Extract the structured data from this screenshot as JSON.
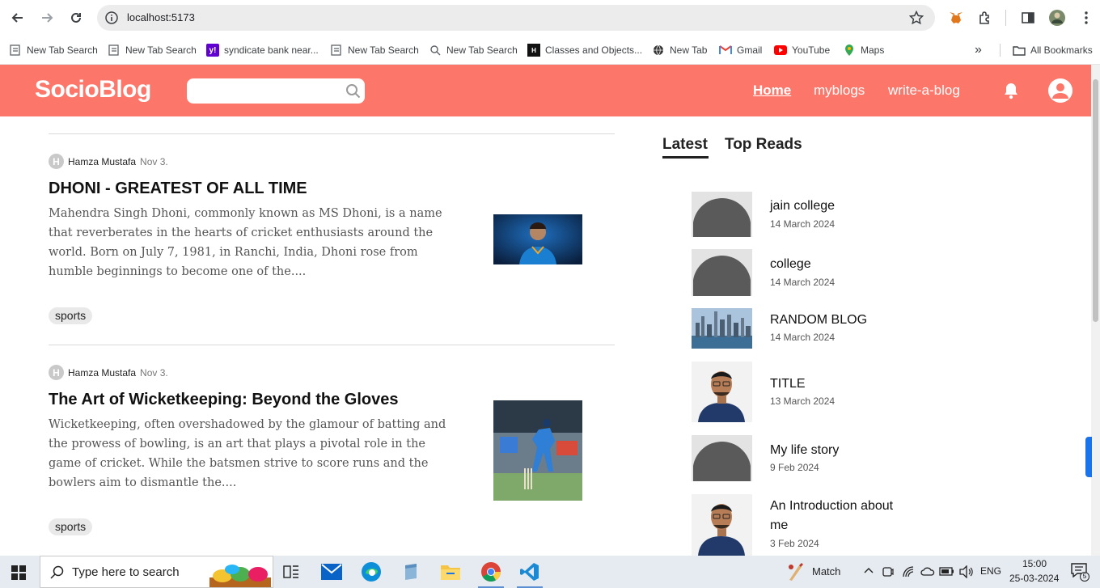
{
  "browser": {
    "url": "localhost:5173",
    "bookmarks": [
      {
        "label": "New Tab Search",
        "icon": "page-icon"
      },
      {
        "label": "New Tab Search",
        "icon": "page-icon"
      },
      {
        "label": "syndicate bank near...",
        "icon": "yahoo-icon"
      },
      {
        "label": "New Tab Search",
        "icon": "page-icon"
      },
      {
        "label": "New Tab Search",
        "icon": "search-icon"
      },
      {
        "label": "Classes and Objects...",
        "icon": "gfg-icon"
      },
      {
        "label": "New Tab",
        "icon": "globe-icon"
      },
      {
        "label": "Gmail",
        "icon": "gmail-icon"
      },
      {
        "label": "YouTube",
        "icon": "youtube-icon"
      },
      {
        "label": "Maps",
        "icon": "maps-icon"
      }
    ],
    "more": "»",
    "all_bookmarks": "All Bookmarks"
  },
  "header": {
    "logo": "SocioBlog",
    "search_placeholder": "",
    "nav": [
      "Home",
      "myblogs",
      "write-a-blog"
    ],
    "accent": "#fc766a"
  },
  "feed": {
    "posts": [
      {
        "author_initial": "H",
        "author": "Hamza Mustafa",
        "date": "Nov 3.",
        "title": "DHONI - GREATEST OF ALL TIME",
        "body": "Mahendra Singh Dhoni, commonly known as MS Dhoni, is a name that reverberates in the hearts of cricket enthusiasts around the world. Born on July 7, 1981, in Ranchi, India, Dhoni rose from humble beginnings to become one of the....",
        "tag": "sports"
      },
      {
        "author_initial": "H",
        "author": "Hamza Mustafa",
        "date": "Nov 3.",
        "title": "The Art of Wicketkeeping: Beyond the Gloves",
        "body": "Wicketkeeping, often overshadowed by the glamour of batting and the prowess of bowling, is an art that plays a pivotal role in the game of cricket. While the batsmen strive to score runs and the bowlers aim to dismantle the....",
        "tag": "sports"
      }
    ]
  },
  "sidebar": {
    "tabs": [
      "Latest",
      "Top Reads"
    ],
    "items": [
      {
        "title": "jain college",
        "date": "14 March 2024"
      },
      {
        "title": "college",
        "date": "14 March 2024"
      },
      {
        "title": "RANDOM BLOG",
        "date": "14 March 2024"
      },
      {
        "title": "TITLE",
        "date": "13 March 2024"
      },
      {
        "title": "My life story",
        "date": "9 Feb 2024"
      },
      {
        "title": "An Introduction about me",
        "date": "3 Feb 2024"
      }
    ]
  },
  "taskbar": {
    "search_placeholder": "Type here to search",
    "weather": "Match",
    "lang": "ENG",
    "time": "15:00",
    "date": "25-03-2024",
    "notifications": "5"
  }
}
